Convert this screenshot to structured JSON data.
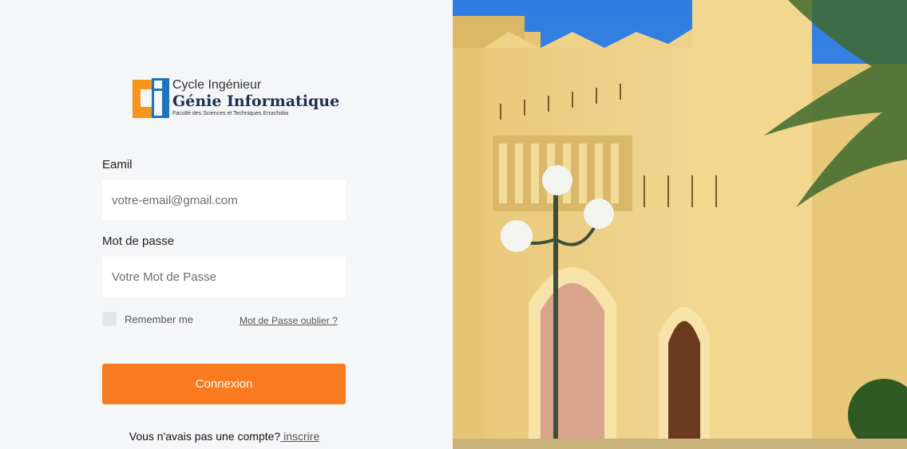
{
  "logo": {
    "line1": "Cycle Ingénieur",
    "line2": "Génie Informatique",
    "line3": "Faculté des Sciences et Techniques Errachidia"
  },
  "form": {
    "email_label": "Eamil",
    "email_placeholder": "votre-email@gmail.com",
    "password_label": "Mot de passe",
    "password_placeholder": "Votre Mot de Passe",
    "remember_label": "Remember me",
    "forgot_link": "Mot de Passe oublier ?",
    "submit_label": "Connexion",
    "signup_text": "Vous n'avais pas une compte?",
    "signup_link": " inscrire"
  },
  "colors": {
    "accent": "#f97a1f",
    "logo_orange": "#f7941d",
    "logo_blue": "#1e73be",
    "background": "#f5f6f8"
  }
}
